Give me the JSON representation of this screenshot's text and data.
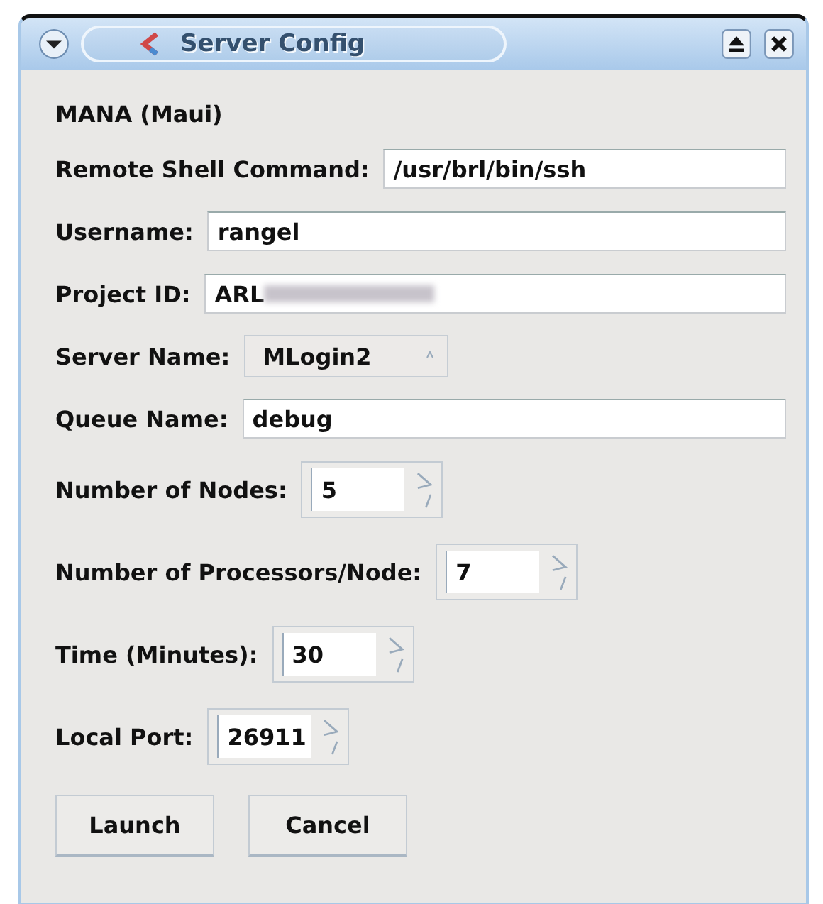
{
  "window": {
    "title": "Server Config"
  },
  "heading": "MANA (Maui)",
  "fields": [
    {
      "kind": "text",
      "label": "Remote Shell Command:",
      "value": "/usr/brl/bin/ssh"
    },
    {
      "kind": "text",
      "label": "Username:",
      "value": "rangel"
    },
    {
      "kind": "text",
      "label": "Project ID:",
      "value": "ARL",
      "redacted": true
    },
    {
      "kind": "combo",
      "label": "Server Name:",
      "value": "MLogin2"
    },
    {
      "kind": "text",
      "label": "Queue Name:",
      "value": "debug"
    },
    {
      "kind": "spin",
      "label": "Number of Nodes:",
      "value": "5"
    },
    {
      "kind": "spin",
      "label": "Number of Processors/Node:",
      "value": "7"
    },
    {
      "kind": "spin",
      "label": "Time (Minutes):",
      "value": "30"
    },
    {
      "kind": "spin",
      "label": "Local Port:",
      "value": "26911"
    }
  ],
  "buttons": [
    "Launch",
    "Cancel"
  ]
}
